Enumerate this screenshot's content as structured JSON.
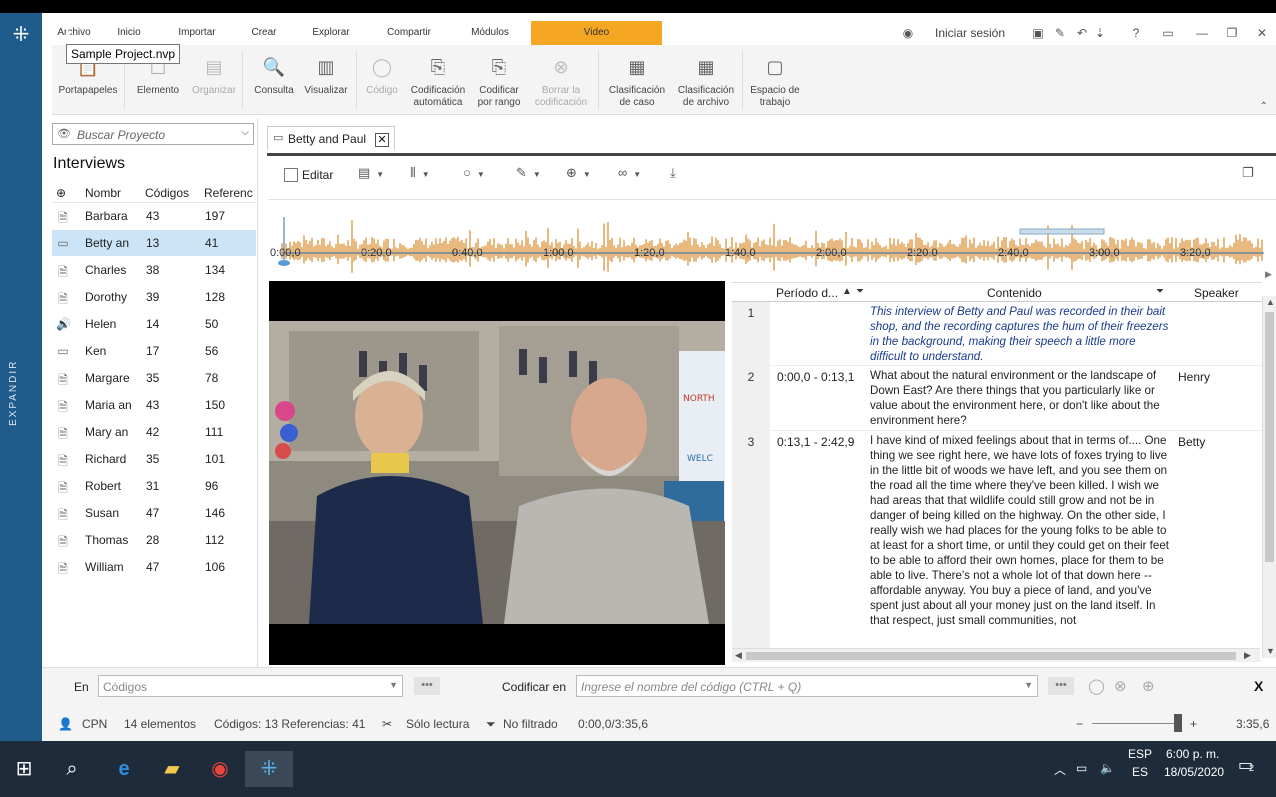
{
  "ribbon_tabs": [
    "Archivo",
    "Inicio",
    "Importar",
    "Crear",
    "Explorar",
    "Compartir",
    "Módulos",
    "Video"
  ],
  "signin_label": "Iniciar sesión",
  "tooltip": "Sample Project.nvp",
  "ribbon_buttons": [
    {
      "label": "Portapapeles",
      "icon": "clipboard-icon",
      "enabled": true
    },
    {
      "label": "Elemento",
      "icon": "document-icon",
      "enabled": true
    },
    {
      "label": "Organizar",
      "icon": "organize-icon",
      "enabled": false
    },
    {
      "label": "Consulta",
      "icon": "query-icon",
      "enabled": true
    },
    {
      "label": "Visualizar",
      "icon": "chart-icon",
      "enabled": true
    },
    {
      "label": "Código",
      "icon": "code-icon",
      "enabled": false
    },
    {
      "label": "Codificación automática",
      "icon": "autocode-icon",
      "enabled": true
    },
    {
      "label": "Codificar por rango",
      "icon": "code-range-icon",
      "enabled": true
    },
    {
      "label": "Borrar la codificación",
      "icon": "uncode-icon",
      "enabled": false
    },
    {
      "label": "Clasificación de caso",
      "icon": "case-classification-icon",
      "enabled": true
    },
    {
      "label": "Clasificación de archivo",
      "icon": "file-classification-icon",
      "enabled": true
    },
    {
      "label": "Espacio de trabajo",
      "icon": "workspace-icon",
      "enabled": true
    }
  ],
  "left_panel": {
    "expand_label": "EXPANDIR",
    "search_placeholder": "Buscar Proyecto",
    "title": "Interviews",
    "columns": [
      "Nombr",
      "Códigos",
      "Referenc"
    ],
    "rows": [
      {
        "name": "Barbara",
        "codes": "43",
        "refs": "197",
        "type": "document",
        "selected": false
      },
      {
        "name": "Betty an",
        "codes": "13",
        "refs": "41",
        "type": "video",
        "selected": true
      },
      {
        "name": "Charles",
        "codes": "38",
        "refs": "134",
        "type": "document",
        "selected": false
      },
      {
        "name": "Dorothy",
        "codes": "39",
        "refs": "128",
        "type": "document",
        "selected": false
      },
      {
        "name": "Helen",
        "codes": "14",
        "refs": "50",
        "type": "audio",
        "selected": false
      },
      {
        "name": "Ken",
        "codes": "17",
        "refs": "56",
        "type": "video",
        "selected": false
      },
      {
        "name": "Margare",
        "codes": "35",
        "refs": "78",
        "type": "document",
        "selected": false
      },
      {
        "name": "Maria an",
        "codes": "43",
        "refs": "150",
        "type": "document",
        "selected": false
      },
      {
        "name": "Mary an",
        "codes": "42",
        "refs": "111",
        "type": "document",
        "selected": false
      },
      {
        "name": "Richard",
        "codes": "35",
        "refs": "101",
        "type": "document",
        "selected": false
      },
      {
        "name": "Robert",
        "codes": "31",
        "refs": "96",
        "type": "document",
        "selected": false
      },
      {
        "name": "Susan",
        "codes": "47",
        "refs": "146",
        "type": "document",
        "selected": false
      },
      {
        "name": "Thomas",
        "codes": "28",
        "refs": "112",
        "type": "document",
        "selected": false
      },
      {
        "name": "William",
        "codes": "47",
        "refs": "106",
        "type": "document",
        "selected": false
      }
    ]
  },
  "doc_tab": {
    "label": "Betty and Paul"
  },
  "video_toolbar": {
    "edit_label": "Editar"
  },
  "timeline_labels": [
    "0:00,0",
    "0:20,0",
    "0:40,0",
    "1:00,0",
    "1:20,0",
    "1:40,0",
    "2:00,0",
    "2:20,0",
    "2:40,0",
    "3:00,0",
    "3:20,0"
  ],
  "wave_color": "#d98a2b",
  "transcript": {
    "columns": [
      "Período d...",
      "Contenido",
      "Speaker"
    ],
    "rows": [
      {
        "num": "1",
        "period": "",
        "content": "This interview of Betty and Paul was recorded in their bait shop, and the recording captures the hum of their freezers in the background, making their speech a little more difficult to understand.",
        "speaker": "",
        "note": true
      },
      {
        "num": "2",
        "period": "0:00,0 - 0:13,1",
        "content": "What about the natural environment or the landscape of Down East? Are there things that you particularly like or value about the environment here, or don't like about the environment here?",
        "speaker": "Henry",
        "note": false
      },
      {
        "num": "3",
        "period": "0:13,1 - 2:42,9",
        "content": "I have kind of mixed feelings about that in terms of.... One thing we see right here, we have lots of foxes trying to live in the little bit of woods we have left, and you see them on the road all the time where they've been killed. I wish we had areas that that wildlife could still grow and not be in danger of being killed on the highway. On the other side, I really wish we had places for the young folks to be able to at least for a short time, or until they could get on their feet to be able to afford their own homes, place for them to be able to live. There's not a whole lot of that down here -- affordable anyway. You buy a piece of land, and you've spent just about all your money just on the land itself. In that respect, just small communities, not",
        "speaker": "Betty",
        "note": false
      }
    ]
  },
  "coding_bar": {
    "in_label": "En",
    "in_placeholder": "Códigos",
    "code_at_label": "Codificar en",
    "code_placeholder": "Ingrese el nombre del código (CTRL + Q)",
    "close_label": "X"
  },
  "status": {
    "user": "CPN",
    "items": "14 elementos",
    "codes_refs": "Códigos: 13  Referencias: 41",
    "readonly": "Sólo lectura",
    "filter": "No filtrado",
    "position": "0:00,0/3:35,6",
    "duration": "3:35,6"
  },
  "taskbar": {
    "lang1": "ESP",
    "lang2": "ES",
    "time": "6:00 p. m.",
    "date": "18/05/2020",
    "notif": "2"
  }
}
